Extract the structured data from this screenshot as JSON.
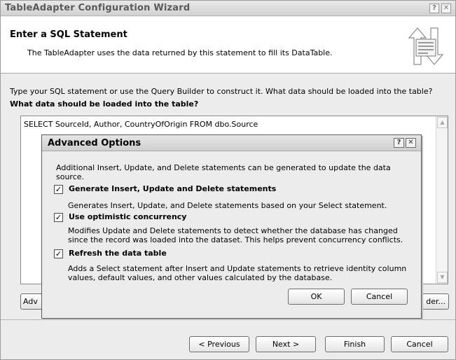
{
  "window": {
    "title": "TableAdapter Configuration Wizard",
    "help_glyph": "?",
    "close_glyph": "✕"
  },
  "header": {
    "title": "Enter a SQL Statement",
    "description": "The TableAdapter uses the data returned by this statement to fill its DataTable."
  },
  "main": {
    "prompt": "Type your SQL statement or use the Query Builder to construct it. What data should be loaded into the table?",
    "question": "What data should be loaded into the table?",
    "sql": "SELECT SourceId, Author, CountryOfOrigin FROM dbo.Source",
    "advanced_button_label": "Adv",
    "query_builder_button_label": "der..."
  },
  "footer": {
    "previous_label": "< Previous",
    "next_label": "Next >",
    "finish_label": "Finish",
    "cancel_label": "Cancel"
  },
  "dialog": {
    "title": "Advanced Options",
    "help_glyph": "?",
    "close_glyph": "✕",
    "intro": "Additional  Insert, Update, and Delete statements can be generated to update the data source.",
    "options": [
      {
        "label": "Generate Insert, Update and Delete statements",
        "checked": true,
        "check_glyph": "✓",
        "description": "Generates Insert, Update, and Delete statements based on your Select statement."
      },
      {
        "label": "Use optimistic concurrency",
        "checked": true,
        "check_glyph": "✓",
        "description": "Modifies Update and Delete statements to detect whether the database has changed since the record was loaded into the dataset. This helps prevent concurrency conflicts."
      },
      {
        "label": "Refresh the data table",
        "checked": true,
        "check_glyph": "✓",
        "description": "Adds a Select statement after Insert and Update statements to retrieve identity column values, default values, and other values calculated by the database."
      }
    ],
    "ok_label": "OK",
    "cancel_label": "Cancel"
  },
  "icons": {
    "wizard": "database-sync-icon",
    "scroll_up": "scroll-up-arrow-icon",
    "scroll_down": "scroll-down-arrow-icon",
    "scroll_up_glyph": "▲",
    "scroll_down_glyph": "▼"
  }
}
